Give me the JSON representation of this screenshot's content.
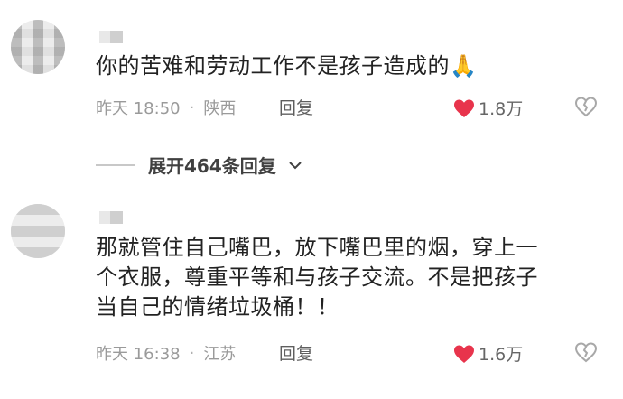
{
  "comments": [
    {
      "text": "你的苦难和劳动工作不是孩子造成的",
      "emoji": "🙏",
      "time": "昨天 18:50",
      "location": "陕西",
      "reply_label": "回复",
      "likes": "1.8万"
    },
    {
      "text_line1": "那就管住自己嘴巴，放下嘴巴里的烟，穿上一",
      "text_line2": "个衣服，尊重平等和与孩子交流。不是把孩子",
      "text_line3": "当自己的情绪垃圾桶！！",
      "time": "昨天 16:38",
      "location": "江苏",
      "reply_label": "回复",
      "likes": "1.6万"
    }
  ],
  "expand": {
    "label": "展开464条回复"
  },
  "colors": {
    "heart": "#e8344c",
    "text": "#222222",
    "meta": "#9a9a9a"
  },
  "icons": [
    "heart-icon",
    "broken-heart-icon",
    "chevron-down-icon",
    "folded-hands-emoji"
  ]
}
